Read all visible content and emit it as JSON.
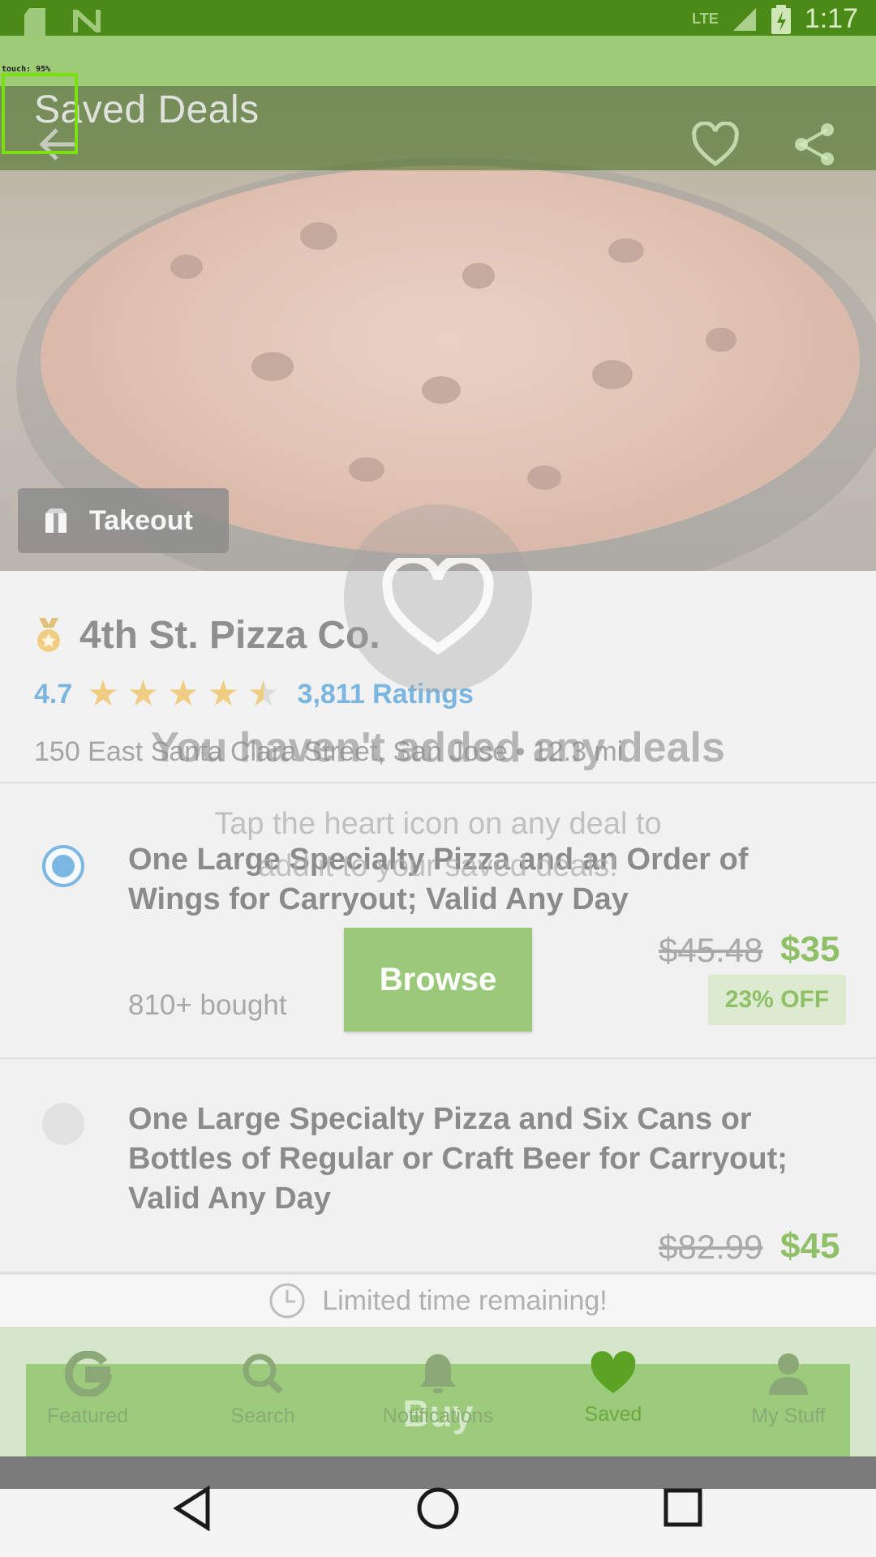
{
  "status_bar": {
    "network": "LTE",
    "time": "1:17"
  },
  "debug": {
    "touch_label": "touch: 95%"
  },
  "header": {
    "title": "Saved Deals"
  },
  "hero": {
    "tag_label": "Takeout"
  },
  "merchant": {
    "name": "4th St. Pizza Co.",
    "rating": "4.7",
    "rating_stars": 4.5,
    "ratings_count": "3,811 Ratings",
    "address": "150 East Santa Clara Street, San Jose • 12.3 mi"
  },
  "deals": [
    {
      "title": "One Large Specialty Pizza and an Order of Wings for Carryout; Valid Any Day",
      "bought": "810+ bought",
      "old_price": "$45.48",
      "new_price": "$35",
      "discount": "23% OFF",
      "selected": true
    },
    {
      "title": "One Large Specialty Pizza and Six Cans or Bottles of Regular or Craft Beer for Carryout; Valid Any Day",
      "old_price": "$82.99",
      "new_price": "$45",
      "selected": false
    }
  ],
  "limited": {
    "text": "Limited time remaining!"
  },
  "buy": {
    "label": "Buy"
  },
  "empty_state": {
    "title": "You haven't added any deals",
    "subtitle_line1": "Tap the heart icon on any deal to",
    "subtitle_line2": "add it to your saved deals!",
    "browse_label": "Browse"
  },
  "bottom_nav": {
    "items": [
      {
        "label": "Featured",
        "icon": "g-logo-icon"
      },
      {
        "label": "Search",
        "icon": "search-icon"
      },
      {
        "label": "Notifications",
        "icon": "bell-icon"
      },
      {
        "label": "Saved",
        "icon": "heart-icon"
      },
      {
        "label": "My Stuff",
        "icon": "person-icon"
      }
    ],
    "active": "Saved"
  },
  "colors": {
    "brand_green": "#53a318",
    "accent_blue": "#7ab6df",
    "price_green": "#8fc067"
  }
}
